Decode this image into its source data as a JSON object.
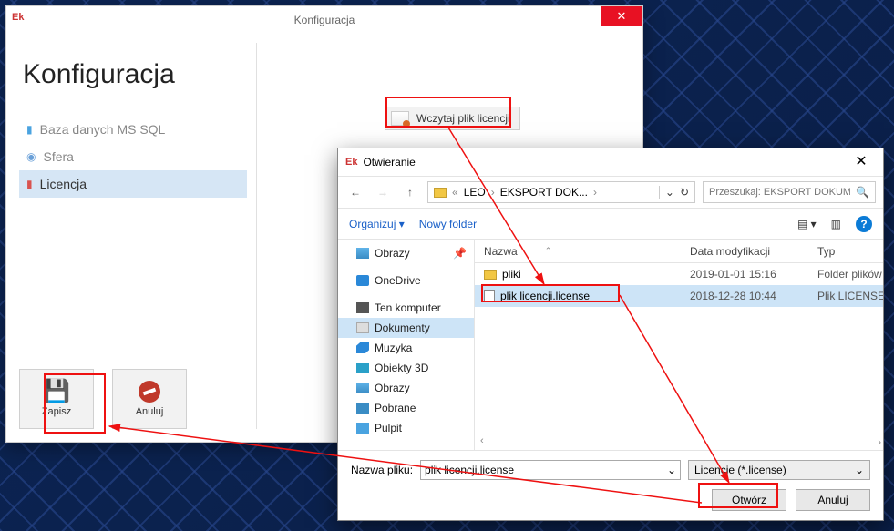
{
  "config_window": {
    "app_icon": "Ek",
    "title": "Konfiguracja",
    "heading": "Konfiguracja",
    "nav": {
      "db": "Baza danych MS SQL",
      "sfera": "Sfera",
      "licencja": "Licencja"
    },
    "load_license": "Wczytaj plik licencji",
    "save": "Zapisz",
    "cancel": "Anuluj"
  },
  "file_dialog": {
    "app_icon": "Ek",
    "title": "Otwieranie",
    "path": {
      "seg1": "LEO",
      "seg2": "EKSPORT DOK..."
    },
    "search_placeholder": "Przeszukaj: EKSPORT DOKUM...",
    "toolbar": {
      "organize": "Organizuj",
      "new_folder": "Nowy folder"
    },
    "tree": {
      "obrazy_q": "Obrazy",
      "onedrive": "OneDrive",
      "ten_komputer": "Ten komputer",
      "dokumenty": "Dokumenty",
      "muzyka": "Muzyka",
      "obiekty3d": "Obiekty 3D",
      "obrazy": "Obrazy",
      "pobrane": "Pobrane",
      "pulpit": "Pulpit"
    },
    "columns": {
      "name": "Nazwa",
      "date": "Data modyfikacji",
      "type": "Typ"
    },
    "rows": [
      {
        "icon": "folder",
        "name": "pliki",
        "date": "2019-01-01 15:16",
        "type": "Folder plików"
      },
      {
        "icon": "file",
        "name": "plik licencji.license",
        "date": "2018-12-28 10:44",
        "type": "Plik LICENSE"
      }
    ],
    "filename_label": "Nazwa pliku:",
    "filename_value": "plik licencji.license",
    "filter": "Licencje (*.license)",
    "open": "Otwórz",
    "cancel": "Anuluj"
  }
}
